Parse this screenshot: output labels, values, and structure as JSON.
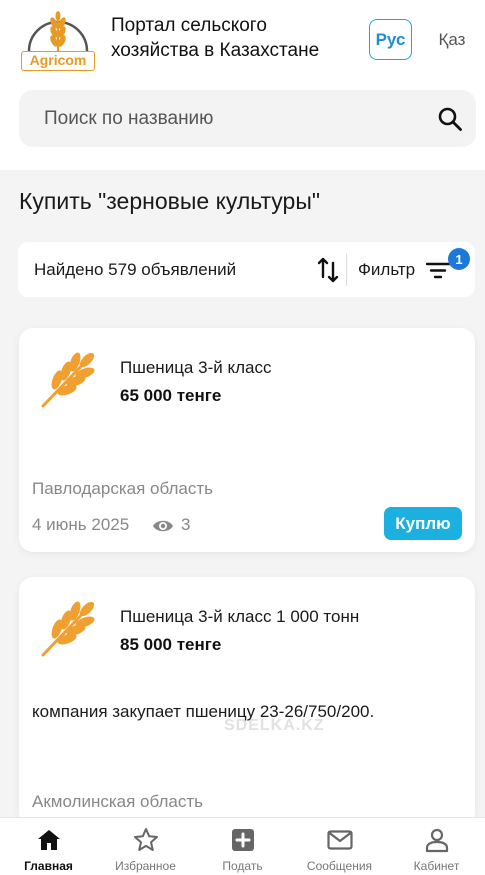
{
  "header": {
    "logo_text": "Agricom",
    "title": "Портал сельского хозяйства в Казахстане",
    "lang_active": "Рус",
    "lang_other": "Қаз"
  },
  "search": {
    "placeholder": "Поиск по названию",
    "value": ""
  },
  "page_title": "Купить \"зерновые культуры\"",
  "results": {
    "count_text": "Найдено 579 объявлений",
    "filter_label": "Фильтр",
    "filter_badge": "1"
  },
  "listings": [
    {
      "title": "Пшеница 3-й класс",
      "price": "65 000 тенге",
      "region": "Павлодарская область",
      "date": "4 июнь 2025",
      "views": "3",
      "type": "Куплю"
    },
    {
      "title": "Пшеница 3-й класс 1 000 тонн",
      "price": "85 000 тенге",
      "description": "компания закупает пшеницу 23-26/750/200.",
      "watermark": "SDELKA.KZ",
      "region": "Акмолинская область"
    }
  ],
  "nav": [
    {
      "label": "Главная",
      "icon": "home-icon",
      "active": true
    },
    {
      "label": "Избранное",
      "icon": "star-icon"
    },
    {
      "label": "Подать",
      "icon": "plus-square-icon"
    },
    {
      "label": "Сообщения",
      "icon": "envelope-icon"
    },
    {
      "label": "Кабинет",
      "icon": "user-icon"
    }
  ],
  "colors": {
    "accent_blue": "#1cb0e0",
    "badge_blue": "#1d79d9",
    "logo_orange": "#e79a25",
    "wheat_orange": "#f0a030"
  }
}
